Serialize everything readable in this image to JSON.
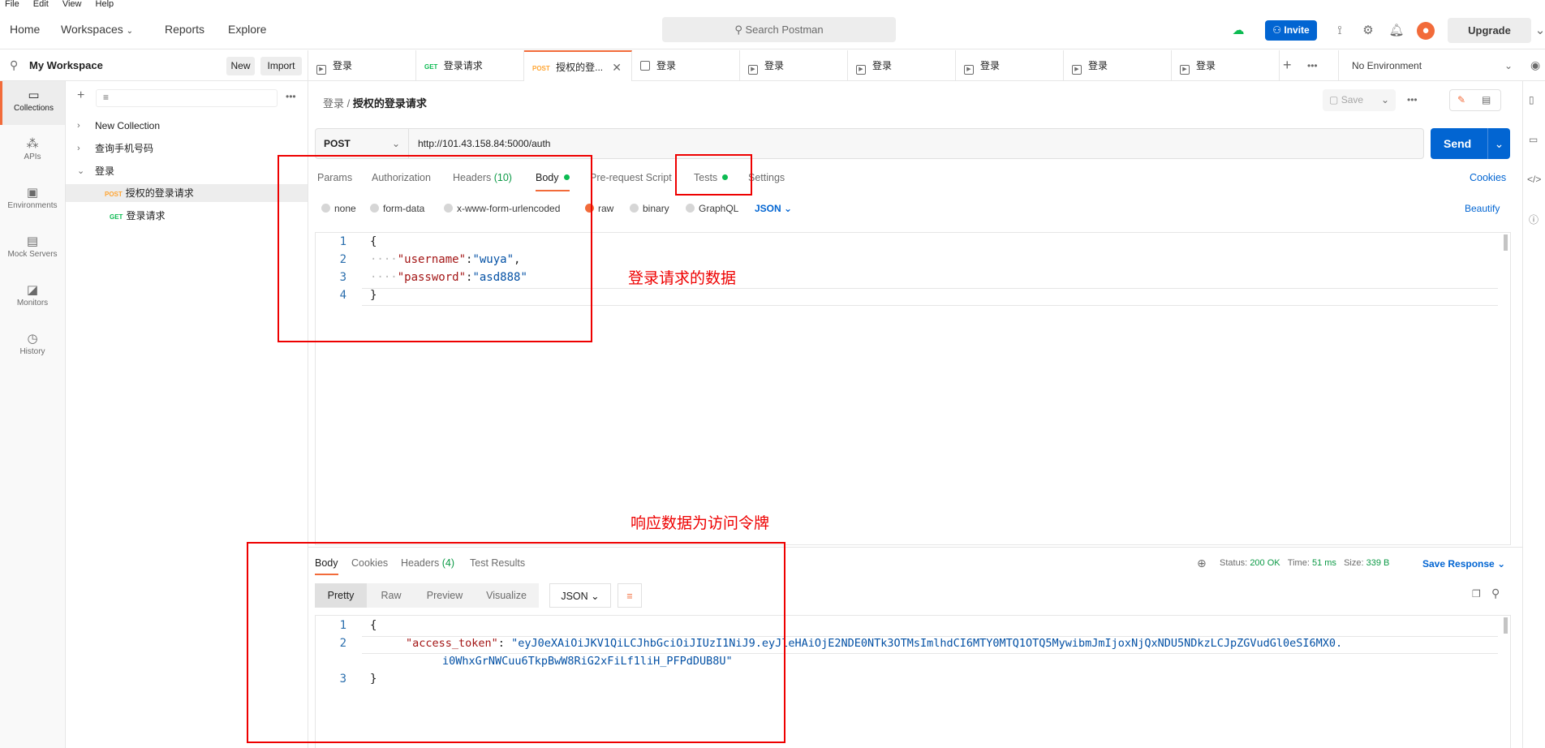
{
  "menubar": {
    "items": [
      "File",
      "Edit",
      "View",
      "Help"
    ]
  },
  "header": {
    "nav": {
      "home": "Home",
      "workspaces": "Workspaces",
      "reports": "Reports",
      "explore": "Explore"
    },
    "search_placeholder": "Search Postman",
    "invite_label": "Invite",
    "upgrade_label": "Upgrade"
  },
  "workspace": {
    "name": "My Workspace",
    "new_label": "New",
    "import_label": "Import"
  },
  "rail": [
    {
      "label": "Collections"
    },
    {
      "label": "APIs"
    },
    {
      "label": "Environments"
    },
    {
      "label": "Mock Servers"
    },
    {
      "label": "Monitors"
    },
    {
      "label": "History"
    }
  ],
  "tree": [
    {
      "label": "New Collection"
    },
    {
      "label": "查询手机号码"
    },
    {
      "label": "登录"
    },
    {
      "method": "POST",
      "label": "授权的登录请求"
    },
    {
      "method": "GET",
      "label": "登录请求"
    }
  ],
  "tabs": [
    {
      "method": "",
      "label": "登录"
    },
    {
      "method": "GET",
      "label": "登录请求"
    },
    {
      "method": "POST",
      "label": "授权的登..."
    },
    {
      "method": "",
      "label": "登录"
    },
    {
      "method": "",
      "label": "登录"
    },
    {
      "method": "",
      "label": "登录"
    },
    {
      "method": "",
      "label": "登录"
    },
    {
      "method": "",
      "label": "登录"
    },
    {
      "method": "",
      "label": "登录"
    }
  ],
  "environment": "No Environment",
  "request": {
    "breadcrumb_parent": "登录",
    "breadcrumb_sep": "/",
    "breadcrumb_current": "授权的登录请求",
    "save_label": "Save",
    "method": "POST",
    "url": "http://101.43.158.84:5000/auth",
    "send_label": "Send",
    "tabs": {
      "params": "Params",
      "authorization": "Authorization",
      "headers": "Headers",
      "headers_count": "(10)",
      "body": "Body",
      "prerequest": "Pre-request Script",
      "tests": "Tests",
      "settings": "Settings"
    },
    "cookies_label": "Cookies",
    "body_types": [
      "none",
      "form-data",
      "x-www-form-urlencoded",
      "raw",
      "binary",
      "GraphQL"
    ],
    "format": "JSON",
    "beautify_label": "Beautify",
    "code_lines": [
      {
        "n": "1",
        "text": "{"
      },
      {
        "n": "2",
        "indent": "····",
        "key": "\"username\"",
        "colon": ":",
        "value": "\"wuya\"",
        "tail": ","
      },
      {
        "n": "3",
        "indent": "····",
        "key": "\"password\"",
        "colon": ":",
        "value": "\"asd888\"",
        "tail": ""
      },
      {
        "n": "4",
        "text": "}"
      }
    ]
  },
  "annotations": {
    "request_data": "登录请求的数据",
    "response_data": "响应数据为访问令牌"
  },
  "response": {
    "tabs": {
      "body": "Body",
      "cookies": "Cookies",
      "headers": "Headers",
      "headers_count": "(4)",
      "test_results": "Test Results"
    },
    "status_label": "Status:",
    "status_value": "200 OK",
    "time_label": "Time:",
    "time_value": "51 ms",
    "size_label": "Size:",
    "size_value": "339 B",
    "save_response": "Save Response",
    "views": [
      "Pretty",
      "Raw",
      "Preview",
      "Visualize"
    ],
    "format": "JSON",
    "code_lines": [
      {
        "n": "1",
        "text": "{"
      },
      {
        "n": "2",
        "key": "\"access_token\"",
        "colon": ": ",
        "value": "\"eyJ0eXAiOiJKV1QiLCJhbGciOiJIUzI1NiJ9.eyJleHAiOjE2NDE0NTk3OTMsImlhdCI6MTY0MTQ1OTQ5MywibmJmIjoxNjQxNDU5NDkzLCJpZGVudGl0eSI6MX0."
      },
      {
        "n": "",
        "value": "i0WhxGrNWCuu6TkpBwW8RiG2xFiLf1liH_PFPdDUB8U\""
      },
      {
        "n": "3",
        "text": "}"
      }
    ]
  },
  "colors": {
    "accent": "#f26b3a",
    "primary": "#0265d2",
    "annotation": "#ee0000",
    "success": "#0cbb52"
  }
}
